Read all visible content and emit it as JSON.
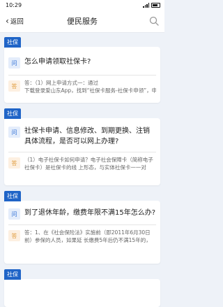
{
  "status_bar": {
    "time": "10:29"
  },
  "header": {
    "back_label": "返回",
    "title": "便民服务"
  },
  "items": [
    {
      "tag": "社保",
      "q_badge": "问",
      "question": "怎么申请领取社保卡?",
      "a_badge": "答",
      "answer_line1": "答：（1）网上申请方式一：通过",
      "answer_line2": "下载登录爱山东App，找到“社保卡服务-社保卡申领”，申请“社保卡邮寄”即可..."
    },
    {
      "tag": "社保",
      "q_badge": "问",
      "question": "社保卡申请、信息修改、到期更换、注销具体流程，是否可以网上办理?",
      "a_badge": "答",
      "answer_line1": "（1）电子社保卡如何申请？电子社会保障卡（简称电子社保卡）是社保卡的线",
      "answer_line2": "上形态，与实体社保卡一一对应、功能..."
    },
    {
      "tag": "社保",
      "q_badge": "问",
      "question": "到了退休年龄，缴费年限不满15年怎么办?",
      "a_badge": "答",
      "answer_line1": "答：1、在《社会保险法》实施前（即2011年6月30日前）参保的人员，如果延",
      "answer_line2": "长缴费5年后仍不满15年的，可以一次性..."
    },
    {
      "tag": "社保"
    }
  ]
}
